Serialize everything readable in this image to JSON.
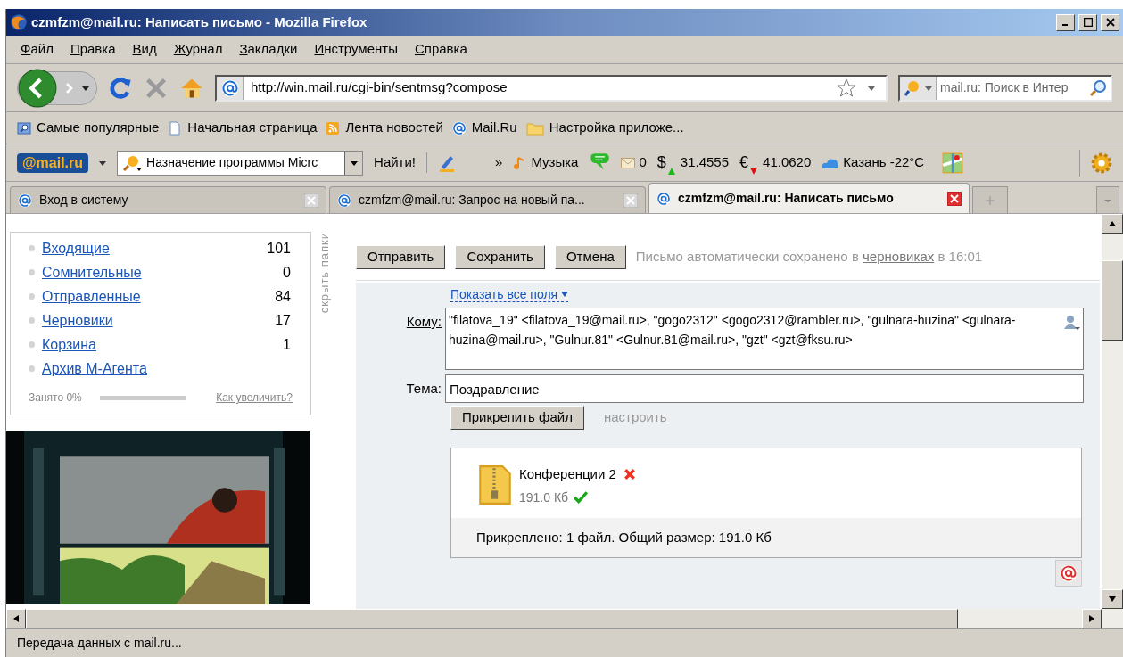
{
  "window": {
    "title": "czmfzm@mail.ru: Написать письмо - Mozilla Firefox"
  },
  "menu": [
    "Файл",
    "Правка",
    "Вид",
    "Журнал",
    "Закладки",
    "Инструменты",
    "Справка"
  ],
  "nav": {
    "url": "http://win.mail.ru/cgi-bin/sentmsg?compose",
    "search_placeholder": "mail.ru: Поиск в Интер"
  },
  "bookmarks": [
    {
      "kind": "search",
      "label": "Самые популярные"
    },
    {
      "kind": "page",
      "label": "Начальная страница"
    },
    {
      "kind": "feed",
      "label": "Лента новостей"
    },
    {
      "kind": "at",
      "label": "Mail.Ru"
    },
    {
      "kind": "folder",
      "label": "Настройка приложе..."
    }
  ],
  "mail_toolbar": {
    "logo": "@mail.ru",
    "search_value": "Назначение программы Micrc",
    "find_button": "Найти!",
    "more": "»",
    "music": "Музыка",
    "mail_count": "0",
    "usd": {
      "symbol": "$",
      "value": "31.4555",
      "rising": true
    },
    "eur": {
      "symbol": "€",
      "value": "41.0620",
      "rising": false
    },
    "weather": "Казань -22°C"
  },
  "tabs": [
    {
      "label": "Вход в систему",
      "selected": false
    },
    {
      "label": "czmfzm@mail.ru: Запрос на новый па...",
      "selected": false
    },
    {
      "label": "czmfzm@mail.ru: Написать письмо",
      "selected": true
    }
  ],
  "folders": [
    {
      "name": "Входящие",
      "count": "101"
    },
    {
      "name": "Сомнительные",
      "count": "0"
    },
    {
      "name": "Отправленные",
      "count": "84"
    },
    {
      "name": "Черновики",
      "count": "17"
    },
    {
      "name": "Корзина",
      "count": "1"
    },
    {
      "name": "Архив М-Агента"
    }
  ],
  "storage": {
    "label": "Занято 0%",
    "link": "Как увеличить?"
  },
  "hide_folders": "скрыть папки",
  "compose": {
    "buttons": [
      "Отправить",
      "Сохранить",
      "Отмена"
    ],
    "autosave": {
      "before": "Письмо автоматически сохранено в",
      "link": "черновиках",
      "after": "в 16:01"
    },
    "show_all_fields": "Показать все поля",
    "to_label": "Кому:",
    "to_value": "\"filatova_19\" <filatova_19@mail.ru>, \"gogo2312\" <gogo2312@rambler.ru>, \"gulnara-huzina\" <gulnara-huzina@mail.ru>, \"Gulnur.81\" <Gulnur.81@mail.ru>, \"gzt\" <gzt@fksu.ru>",
    "subject_label": "Тема:",
    "subject_value": "Поздравление",
    "attach_button": "Прикрепить файл",
    "configure_link": "настроить",
    "attachments": [
      {
        "name": "Конференции 2",
        "size": "191.0 Кб",
        "uploaded": true
      }
    ],
    "summary": "Прикреплено: 1 файл. Общий размер: 191.0 Кб"
  },
  "status_bar": "Передача данных с mail.ru..."
}
